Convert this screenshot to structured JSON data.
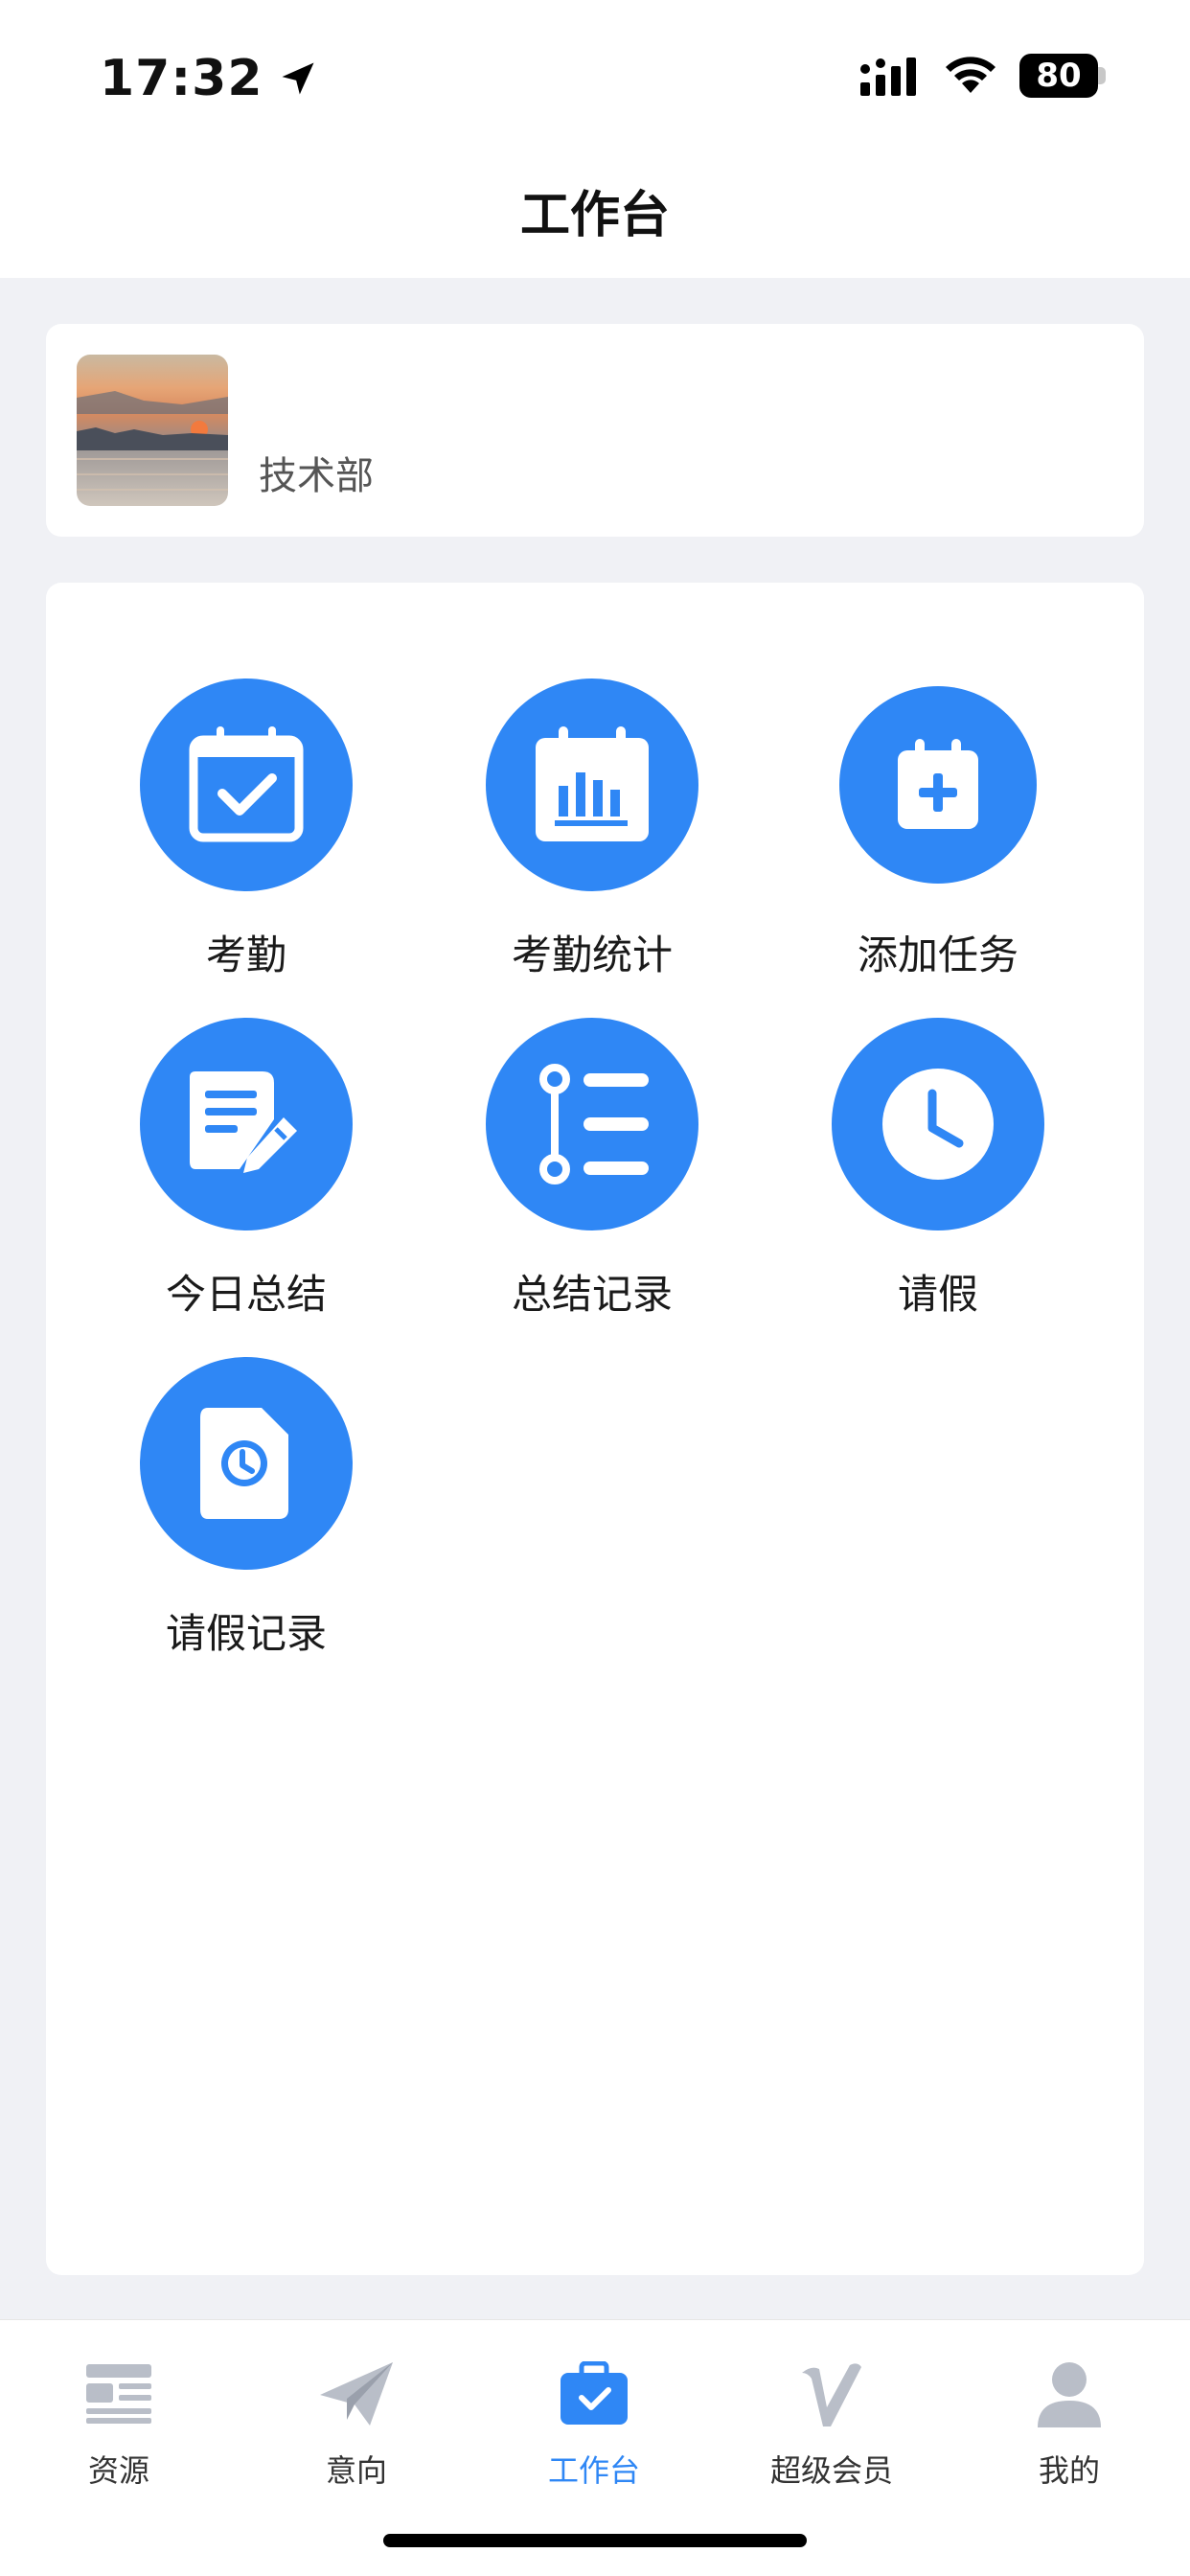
{
  "status_bar": {
    "time": "17:32",
    "battery": "80"
  },
  "header": {
    "title": "工作台"
  },
  "profile": {
    "name": "",
    "department": "技术部"
  },
  "tiles": [
    {
      "label": "考勤",
      "icon": "calendar-check-icon"
    },
    {
      "label": "考勤统计",
      "icon": "bar-chart-calendar-icon"
    },
    {
      "label": "添加任务",
      "icon": "calendar-plus-icon"
    },
    {
      "label": "今日总结",
      "icon": "document-edit-icon"
    },
    {
      "label": "总结记录",
      "icon": "timeline-list-icon"
    },
    {
      "label": "请假",
      "icon": "clock-icon"
    },
    {
      "label": "请假记录",
      "icon": "file-clock-icon"
    }
  ],
  "tabbar": {
    "items": [
      {
        "label": "资源",
        "icon": "newspaper-icon",
        "active": false
      },
      {
        "label": "意向",
        "icon": "paper-plane-icon",
        "active": false
      },
      {
        "label": "工作台",
        "icon": "briefcase-check-icon",
        "active": true
      },
      {
        "label": "超级会员",
        "icon": "v-logo-icon",
        "active": false
      },
      {
        "label": "我的",
        "icon": "person-icon",
        "active": false
      }
    ]
  },
  "colors": {
    "accent": "#2f87f5",
    "background": "#f0f1f5",
    "inactive_icon": "#b9bec8"
  }
}
